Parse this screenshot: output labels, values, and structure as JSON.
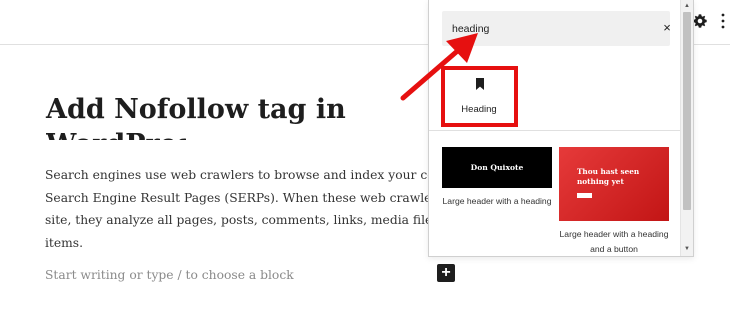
{
  "editor": {
    "title_line1": "Add Nofollow tag in",
    "title_line2": "WordPress",
    "paragraph_lines": [
      "Search engines use web crawlers to browse and index your content on",
      "Search Engine Result Pages (SERPs). When these web crawlers enter yo",
      "site, they analyze all pages, posts, comments, links, media files, and oth",
      "items."
    ],
    "placeholder": "Start writing or type / to choose a block",
    "add_block_symbol": "+"
  },
  "toolbar": {
    "icons": [
      "gear-icon",
      "kebab-menu-icon"
    ]
  },
  "inserter": {
    "search_value": "heading",
    "clear_symbol": "×",
    "blocks": [
      {
        "label": "Heading",
        "icon": "bookmark-icon"
      }
    ],
    "patterns": [
      {
        "preview_text": "Don Quixote",
        "label": "Large header with a heading"
      },
      {
        "preview_text": "Thou hast seen nothing yet",
        "label": "Large header with a heading and a button"
      }
    ]
  },
  "colors": {
    "highlight": "#e61010",
    "dark": "#1e1e1e",
    "pattern_red": "#d42020"
  }
}
